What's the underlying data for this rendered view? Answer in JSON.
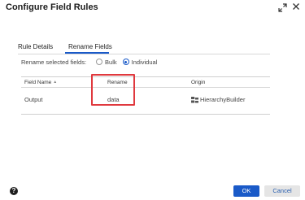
{
  "dialog": {
    "title": "Configure Field Rules",
    "expand_icon": "expand-icon",
    "close_icon": "close-icon"
  },
  "tabs": [
    {
      "label": "Rule Details",
      "active": false
    },
    {
      "label": "Rename Fields",
      "active": true
    }
  ],
  "rename_mode": {
    "label": "Rename selected fields:",
    "options": [
      {
        "label": "Bulk",
        "selected": false
      },
      {
        "label": "Individual",
        "selected": true
      }
    ]
  },
  "table": {
    "columns": [
      "Field Name",
      "Rename",
      "Origin"
    ],
    "sort_icon": "sort-up-icon",
    "rows": [
      {
        "field_name": "Output",
        "rename": "data",
        "origin": "HierarchyBuilder",
        "origin_icon": "hierarchy-builder-icon"
      }
    ]
  },
  "footer": {
    "help_icon": "help-icon",
    "help_glyph": "?",
    "ok_label": "OK",
    "cancel_label": "Cancel"
  },
  "colors": {
    "accent": "#1a5ac8",
    "highlight": "#e0393e"
  }
}
